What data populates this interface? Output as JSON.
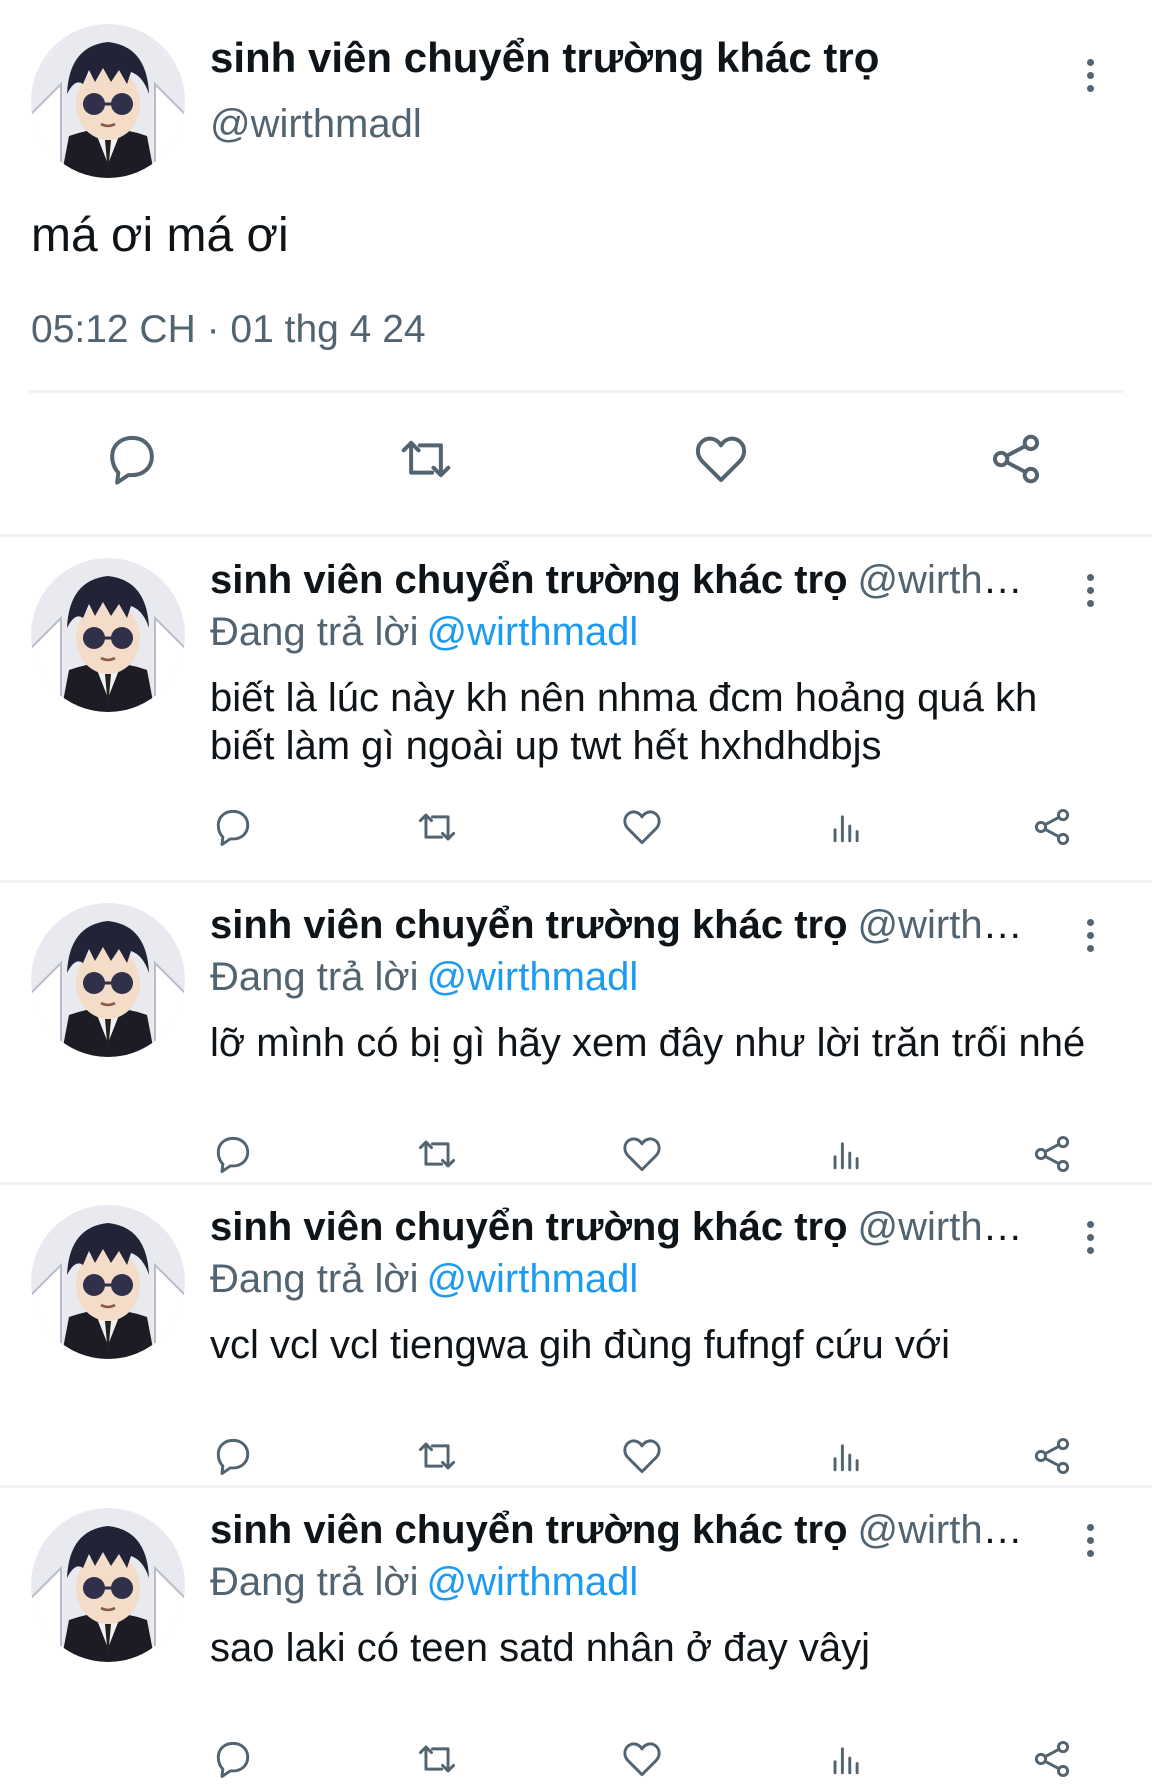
{
  "main_tweet": {
    "display_name": "sinh viên chuyển trường khác trọ",
    "handle": "@wirthmadl",
    "text": "má ơi má ơi",
    "timestamp": "05:12 CH · 01 thg 4 24",
    "actions": [
      "reply-icon",
      "retweet-icon",
      "like-icon",
      "share-icon"
    ]
  },
  "replies": [
    {
      "display_name": "sinh viên chuyển trường khác trọ",
      "handle": "@wirthm...",
      "replying_label": "Đang trả lời",
      "replying_to": "@wirthmadl",
      "text": "biết là lúc này kh nên nhma đcm hoảng quá kh biết làm gì ngoài up twt hết hxhdhdbjs"
    },
    {
      "display_name": "sinh viên chuyển trường khác trọ",
      "handle": "@wirthm...",
      "replying_label": "Đang trả lời",
      "replying_to": "@wirthmadl",
      "text": "lỡ mình có bị gì hãy xem đây như lời trăn trối nhé"
    },
    {
      "display_name": "sinh viên chuyển trường khác trọ",
      "handle": "@wirthm...",
      "replying_label": "Đang trả lời",
      "replying_to": "@wirthmadl",
      "text": "vcl vcl vcl tiengwa gih đùng fufngf cứu với"
    },
    {
      "display_name": "sinh viên chuyển trường khác trọ",
      "handle": "@wirthm...",
      "replying_label": "Đang trả lời",
      "replying_to": "@wirthmadl",
      "text": "sao laki có teen satd nhân ở đay vâyj"
    }
  ],
  "colors": {
    "text": "#0f1419",
    "secondary": "#536471",
    "link": "#1d9bf0",
    "divider": "#eff3f4"
  }
}
